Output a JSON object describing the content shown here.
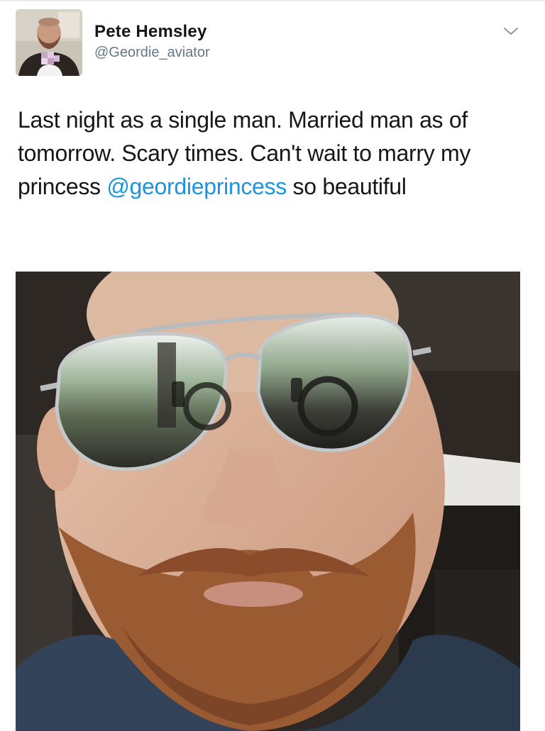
{
  "user": {
    "display_name": "Pete Hemsley",
    "handle": "@Geordie_aviator"
  },
  "header": {
    "menu_icon": "chevron-down-icon"
  },
  "tweet": {
    "text_before": "Last night as a single man. Married man as of tomorrow. Scary times. Can't wait to marry my princess ",
    "mention": "@geordieprincess",
    "text_after": " so beautiful"
  },
  "colors": {
    "name": "#14171a",
    "handle": "#657786",
    "mention": "#1b95e0",
    "chevron": "#8899a6"
  }
}
